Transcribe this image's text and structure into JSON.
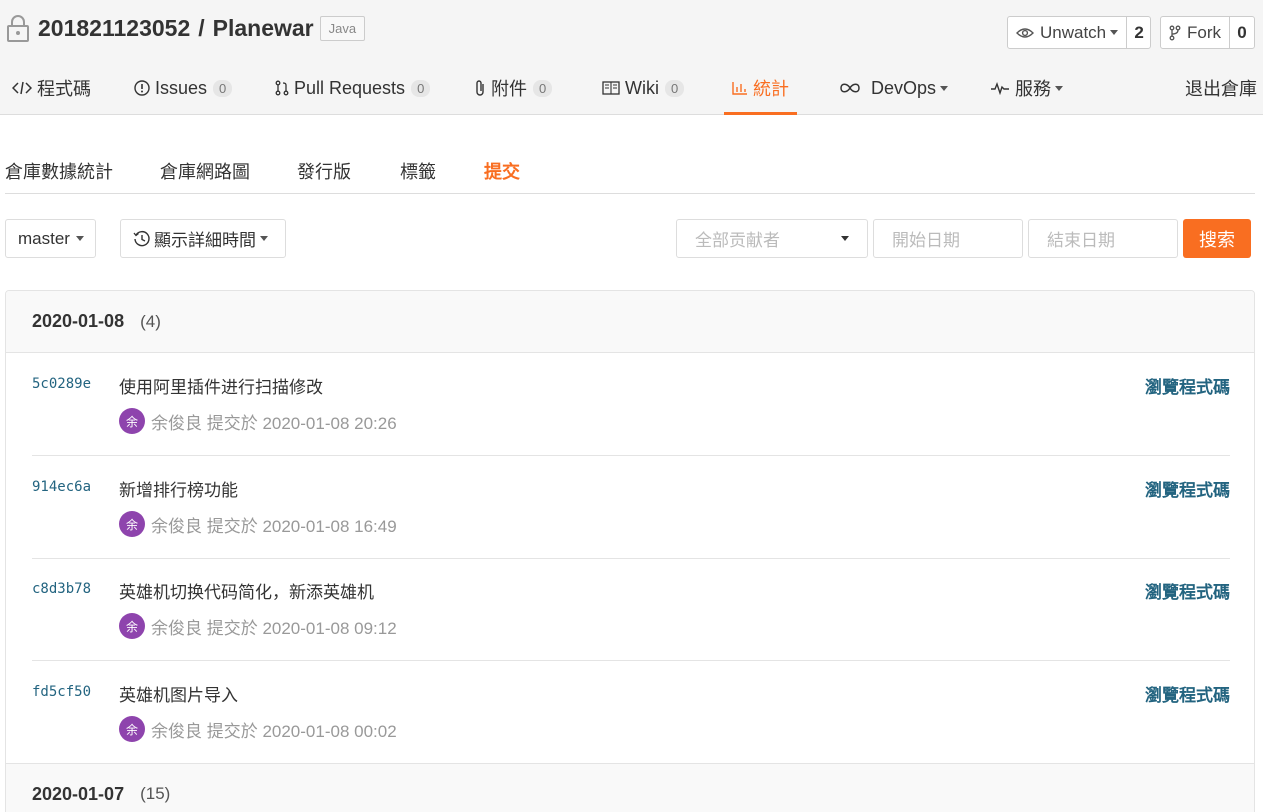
{
  "repo": {
    "owner": "201821123052",
    "separator": "/",
    "name": "Planewar",
    "language": "Java"
  },
  "watch": {
    "label": "Unwatch",
    "count": "2"
  },
  "fork": {
    "label": "Fork",
    "count": "0"
  },
  "tabs": [
    {
      "label": "程式碼"
    },
    {
      "label": "Issues",
      "count": "0"
    },
    {
      "label": "Pull Requests",
      "count": "0"
    },
    {
      "label": "附件",
      "count": "0"
    },
    {
      "label": "Wiki",
      "count": "0"
    },
    {
      "label": "統計"
    },
    {
      "label": "DevOps"
    },
    {
      "label": "服務"
    },
    {
      "label": "退出倉庫"
    }
  ],
  "subnav": [
    "倉庫數據統計",
    "倉庫網路圖",
    "發行版",
    "標籤",
    "提交"
  ],
  "filters": {
    "branch": "master",
    "time_label": "顯示詳細時間",
    "author_placeholder": "全部贡献者",
    "start_placeholder": "開始日期",
    "end_placeholder": "結束日期",
    "search_label": "搜索"
  },
  "groups": [
    {
      "date": "2020-01-08",
      "count": "(4)"
    },
    {
      "date": "2020-01-07",
      "count": "(15)"
    }
  ],
  "commits": [
    {
      "sha": "5c0289e",
      "message": "使用阿里插件进行扫描修改",
      "avatar": "余",
      "meta": "余俊良 提交於 2020-01-08 20:26",
      "browse": "瀏覽程式碼"
    },
    {
      "sha": "914ec6a",
      "message": "新增排行榜功能",
      "avatar": "余",
      "meta": "余俊良 提交於 2020-01-08 16:49",
      "browse": "瀏覽程式碼"
    },
    {
      "sha": "c8d3b78",
      "message": "英雄机切换代码简化，新添英雄机",
      "avatar": "余",
      "meta": "余俊良 提交於 2020-01-08 09:12",
      "browse": "瀏覽程式碼"
    },
    {
      "sha": "fd5cf50",
      "message": "英雄机图片导入",
      "avatar": "余",
      "meta": "余俊良 提交於 2020-01-08 00:02",
      "browse": "瀏覽程式碼"
    }
  ],
  "colors": {
    "accent": "#f96e21",
    "link": "#236480",
    "avatar": "#8e44ad"
  }
}
